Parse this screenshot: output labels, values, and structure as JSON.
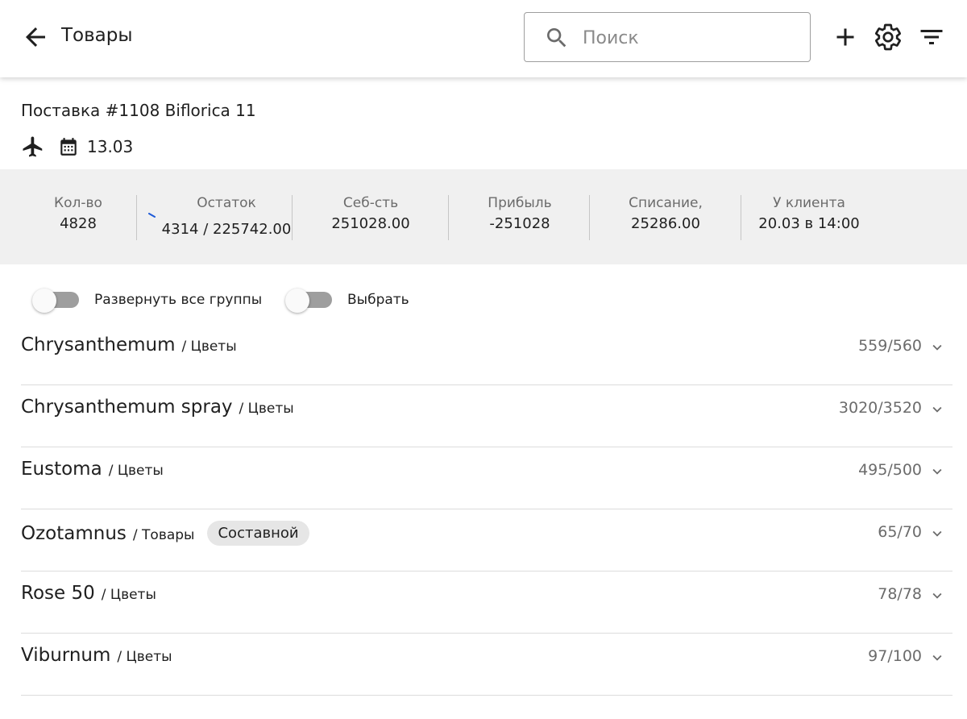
{
  "header": {
    "title": "Товары",
    "search_placeholder": "Поиск",
    "search_value": ""
  },
  "delivery": {
    "title": "Поставка #1108 Bifloricа 11",
    "date": "13.03"
  },
  "stats": [
    {
      "label": "Кол-во",
      "value": "4828"
    },
    {
      "label": "Остаток",
      "value": "4314 / 225742.00"
    },
    {
      "label": "Себ-сть",
      "value": "251028.00"
    },
    {
      "label": "Прибыль",
      "value": "-251028"
    },
    {
      "label": "Списание,",
      "value": "25286.00"
    },
    {
      "label": "У клиента",
      "value": "20.03 в 14:00"
    }
  ],
  "toggles": {
    "expand_all": "Развернуть все группы",
    "select": "Выбрать"
  },
  "groups": [
    {
      "name": "Chrysanthemum",
      "category": "/ Цветы",
      "chip": "",
      "count": "559/560"
    },
    {
      "name": "Chrysanthemum spray",
      "category": "/ Цветы",
      "chip": "",
      "count": "3020/3520"
    },
    {
      "name": "Eustoma",
      "category": "/ Цветы",
      "chip": "",
      "count": "495/500"
    },
    {
      "name": "Ozotamnus",
      "category": "/ Товары",
      "chip": "Составной",
      "count": "65/70"
    },
    {
      "name": "Rose 50",
      "category": "/ Цветы",
      "chip": "",
      "count": "78/78"
    },
    {
      "name": "Viburnum",
      "category": "/ Цветы",
      "chip": "",
      "count": "97/100"
    }
  ],
  "colors": {
    "header_bg": "#ffffff",
    "stats_bg": "#f0f0f0",
    "toggle_track": "#9e9e9e",
    "chip_bg": "#e6e6e6",
    "accent_tick": "#1e5bd8"
  },
  "icons": {
    "back": "arrow-left-icon",
    "search": "search-icon",
    "add": "plus-icon",
    "settings": "gear-icon",
    "filter": "filter-icon",
    "plane": "plane-icon",
    "calendar": "calendar-icon",
    "expand": "chevron-down-icon"
  }
}
